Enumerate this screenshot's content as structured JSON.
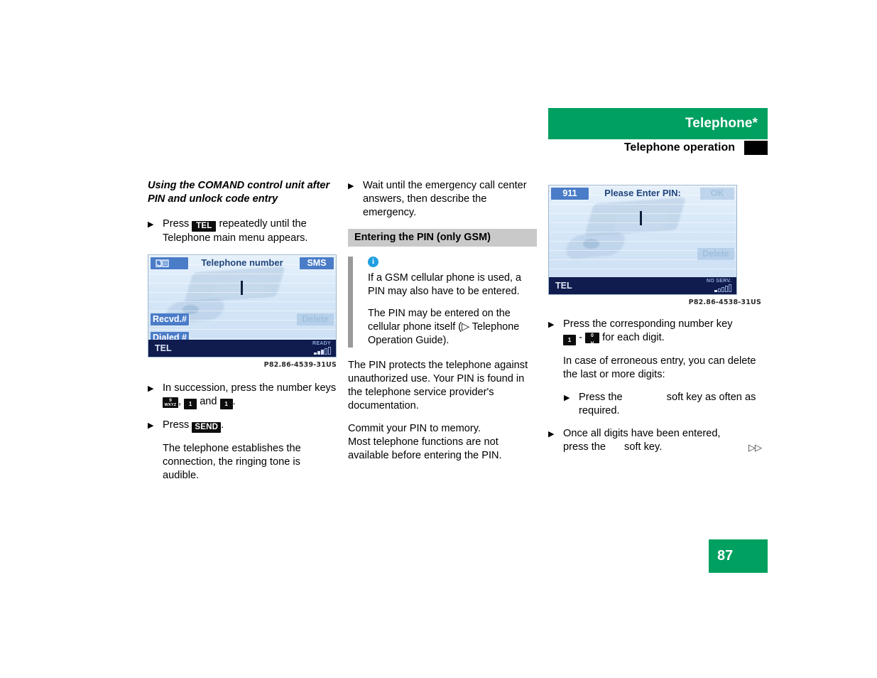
{
  "header": {
    "title": "Telephone*",
    "subtitle": "Telephone operation"
  },
  "page": {
    "number": "87"
  },
  "column1": {
    "section_heading": "Using the COMAND control unit after PIN and unlock code entry",
    "bullet1_pre": "Press",
    "bullet1_key": "TEL",
    "bullet1_post": "repeatedly until the Telephone main menu appears.",
    "figure": {
      "softkey_phonebook": "phonebook-icon",
      "title": "Telephone number",
      "softkey_sms": "SMS",
      "softkey_recvd": "Recvd.#",
      "softkey_dialed": "Dialed #",
      "softkey_delete": "Delete",
      "status_label": "TEL",
      "status_signal": "READY",
      "caption": "P82.86-4539-31US"
    },
    "bullet2_pre": "In succession, press the number keys",
    "bullet2_key9_top": "9",
    "bullet2_key9_bottom": "WXYZ",
    "bullet2_sep1": ",",
    "bullet2_key1a": "1",
    "bullet2_and": "and",
    "bullet2_key1b": "1",
    "bullet2_end": ".",
    "bullet3_pre": "Press",
    "bullet3_key": "SEND",
    "bullet3_end": ".",
    "para1": "The telephone establishes the connection, the ringing tone is audible."
  },
  "column2": {
    "bullet1": "Wait until the emergency call center answers, then describe the emergency.",
    "gray_heading": "Entering the PIN (only GSM)",
    "note": {
      "icon": "info-icon",
      "p1": "If a GSM cellular phone is used, a PIN may also have to be entered.",
      "p2": "The PIN may be entered on the cellular phone itself (▷ Telephone Operation Guide)."
    },
    "para1": "The PIN protects the telephone against unauthorized use. Your PIN is found in the telephone service provider's documentation.",
    "para2_line1": "Commit your PIN to memory.",
    "para2_line2": "Most telephone functions are not available before entering the PIN."
  },
  "column3": {
    "figure": {
      "softkey_911": "911",
      "title": "Please Enter PIN:",
      "softkey_ok": "OK",
      "softkey_delete": "Delete",
      "status_label": "TEL",
      "status_signal": "NO SERV.",
      "caption": "P82.86-4538-31US"
    },
    "bullet1_pre": "Press the corresponding number key",
    "bullet1_key1": "1",
    "bullet1_dash": "-",
    "bullet1_key0_top": "0",
    "bullet1_key0_bottom": "␣",
    "bullet1_post": "for each digit.",
    "para1": "In case of erroneous entry, you can delete the last or more digits:",
    "bullet2_pre": "Press the",
    "bullet2_post": "soft key as often as required.",
    "bullet3_line1": "Once all digits have been entered,",
    "bullet3_pre": "press the",
    "bullet3_post": "soft key.",
    "continuation": "▷▷"
  }
}
